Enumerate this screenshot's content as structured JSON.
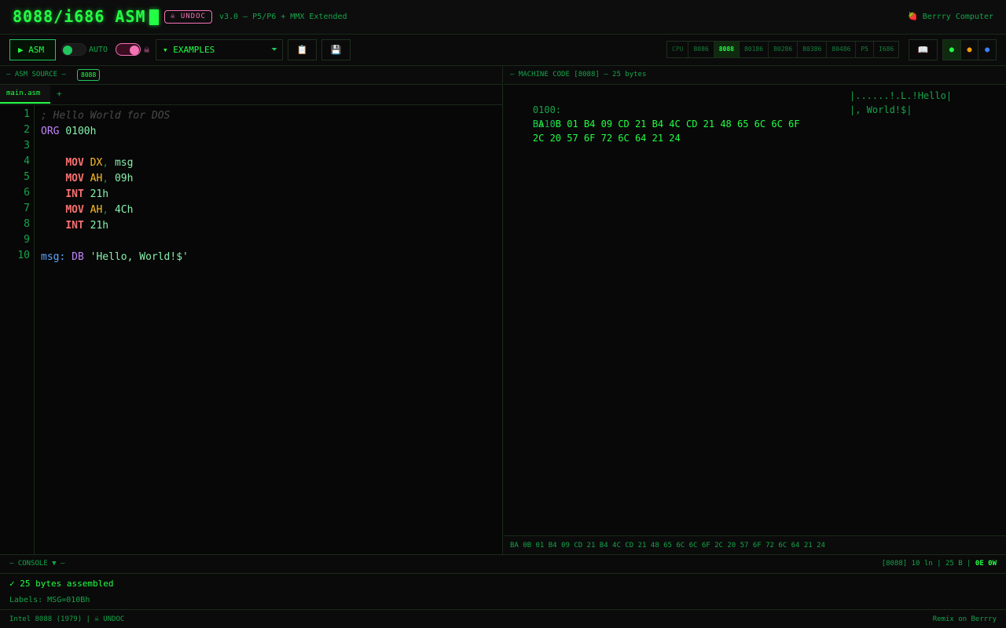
{
  "header": {
    "title": "8088/i686 ASM",
    "undoc_badge": "☠ UNDOC",
    "version": "v3.0 — P5/P6 + MMX Extended",
    "brand": "🍓 Berrry Computer"
  },
  "toolbar": {
    "asm_label": "▶ ASM",
    "auto_label": "AUTO",
    "undoc_icon": "☠",
    "examples_label": "▾ EXAMPLES",
    "examples_caret": "⏷",
    "copy_icon": "📋",
    "save_icon": "💾",
    "cpu_label": "CPU",
    "cpu_options": [
      "8086",
      "8088",
      "80186",
      "80286",
      "80386",
      "80486",
      "P5",
      "I686"
    ],
    "cpu_selected": "8088",
    "book_icon": "📖",
    "themes": [
      {
        "name": "green",
        "glyph": "●",
        "color": "#22ff44"
      },
      {
        "name": "amber",
        "glyph": "●",
        "color": "#f59e0b"
      },
      {
        "name": "blue",
        "glyph": "●",
        "color": "#3b82f6"
      }
    ]
  },
  "source": {
    "header_label": "— ASM SOURCE —",
    "cpu_tag": "8088",
    "tab": "main.asm",
    "add_tab": "+",
    "line_numbers": [
      "1",
      "2",
      "3",
      "4",
      "5",
      "6",
      "7",
      "8",
      "9",
      "10"
    ],
    "lines": [
      {
        "indent": "",
        "tokens": [
          {
            "t": "comment",
            "v": "; Hello World for DOS"
          }
        ]
      },
      {
        "indent": "",
        "tokens": [
          {
            "t": "dir",
            "v": "ORG"
          },
          {
            "t": "sp",
            "v": " "
          },
          {
            "t": "num",
            "v": "0100h"
          }
        ]
      },
      {
        "indent": "",
        "tokens": []
      },
      {
        "indent": "    ",
        "tokens": [
          {
            "t": "op",
            "v": "MOV"
          },
          {
            "t": "sp",
            "v": " "
          },
          {
            "t": "reg",
            "v": "DX"
          },
          {
            "t": "punc",
            "v": ","
          },
          {
            "t": "sp",
            "v": " "
          },
          {
            "t": "id",
            "v": "msg"
          }
        ]
      },
      {
        "indent": "    ",
        "tokens": [
          {
            "t": "op",
            "v": "MOV"
          },
          {
            "t": "sp",
            "v": " "
          },
          {
            "t": "reg",
            "v": "AH"
          },
          {
            "t": "punc",
            "v": ","
          },
          {
            "t": "sp",
            "v": " "
          },
          {
            "t": "num",
            "v": "09h"
          }
        ]
      },
      {
        "indent": "    ",
        "tokens": [
          {
            "t": "op",
            "v": "INT"
          },
          {
            "t": "sp",
            "v": " "
          },
          {
            "t": "num",
            "v": "21h"
          }
        ]
      },
      {
        "indent": "    ",
        "tokens": [
          {
            "t": "op",
            "v": "MOV"
          },
          {
            "t": "sp",
            "v": " "
          },
          {
            "t": "reg",
            "v": "AH"
          },
          {
            "t": "punc",
            "v": ","
          },
          {
            "t": "sp",
            "v": " "
          },
          {
            "t": "num",
            "v": "4Ch"
          }
        ]
      },
      {
        "indent": "    ",
        "tokens": [
          {
            "t": "op",
            "v": "INT"
          },
          {
            "t": "sp",
            "v": " "
          },
          {
            "t": "num",
            "v": "21h"
          }
        ]
      },
      {
        "indent": "",
        "tokens": []
      },
      {
        "indent": "",
        "tokens": [
          {
            "t": "label",
            "v": "msg:"
          },
          {
            "t": "sp",
            "v": " "
          },
          {
            "t": "dir",
            "v": "DB"
          },
          {
            "t": "sp",
            "v": " "
          },
          {
            "t": "str",
            "v": "'Hello, World!$'"
          }
        ]
      }
    ]
  },
  "machine_code": {
    "header_label": "— MACHINE CODE [8088] — 25 bytes",
    "rows": [
      {
        "addr": "0100:",
        "bytes": "BA 0B 01 B4 09 CD 21 B4 4C CD 21 48 65 6C 6C 6F",
        "ascii": "|......!.L.!Hello|"
      },
      {
        "addr": "0110:",
        "bytes": "2C 20 57 6F 72 6C 64 21 24",
        "ascii": "|, World!$|"
      }
    ],
    "strip": "BA 0B 01 B4 09 CD 21 B4 4C CD 21 48 65 6C 6C 6F 2C 20 57 6F 72 6C 64 21 24"
  },
  "console": {
    "title": "— CONSOLE ▼ —",
    "stats": "[8088] 10 ln | 25 B | ",
    "stats_highlight": "0E 0W",
    "success": "✓ 25 bytes assembled",
    "labels": "Labels: MSG=010Bh"
  },
  "footer": {
    "left": "Intel 8088 (1979) | ☠ UNDOC",
    "right": "Remix on Berrry"
  }
}
